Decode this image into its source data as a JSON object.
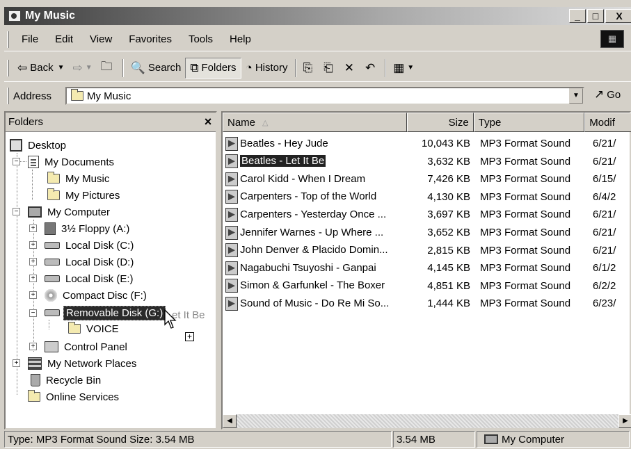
{
  "window": {
    "title": "My Music"
  },
  "menu": [
    "File",
    "Edit",
    "View",
    "Favorites",
    "Tools",
    "Help"
  ],
  "toolbar": {
    "back": "Back",
    "search": "Search",
    "folders": "Folders",
    "history": "History"
  },
  "address": {
    "label": "Address",
    "value": "My Music",
    "go": "Go"
  },
  "folders_pane": {
    "title": "Folders",
    "tree": [
      {
        "label": "Desktop",
        "icon": "desktop-icon"
      },
      {
        "label": "My Documents",
        "icon": "documents-icon"
      },
      {
        "label": "My Music",
        "icon": "folder-icon"
      },
      {
        "label": "My Pictures",
        "icon": "pictures-folder-icon"
      },
      {
        "label": "My Computer",
        "icon": "computer-icon"
      },
      {
        "label": "3½ Floppy (A:)",
        "icon": "floppy-icon"
      },
      {
        "label": "Local Disk (C:)",
        "icon": "drive-icon"
      },
      {
        "label": "Local Disk (D:)",
        "icon": "drive-icon"
      },
      {
        "label": "Local Disk (E:)",
        "icon": "drive-icon"
      },
      {
        "label": "Compact Disc (F:)",
        "icon": "cd-icon"
      },
      {
        "label": "Removable Disk (G:)",
        "icon": "removable-drive-icon"
      },
      {
        "label": "VOICE",
        "icon": "folder-icon"
      },
      {
        "label": "Control Panel",
        "icon": "control-panel-icon"
      },
      {
        "label": "My Network Places",
        "icon": "network-icon"
      },
      {
        "label": "Recycle Bin",
        "icon": "recycle-bin-icon"
      },
      {
        "label": "Online Services",
        "icon": "folder-icon"
      }
    ],
    "drag_ghost": "et It Be"
  },
  "list": {
    "columns": [
      "Name",
      "Size",
      "Type",
      "Modif"
    ],
    "rows": [
      {
        "name": "Beatles - Hey Jude",
        "size": "10,043 KB",
        "type": "MP3 Format Sound",
        "modified": "6/21/"
      },
      {
        "name": "Beatles - Let It Be",
        "size": "3,632 KB",
        "type": "MP3 Format Sound",
        "modified": "6/21/"
      },
      {
        "name": "Carol Kidd - When I Dream",
        "size": "7,426 KB",
        "type": "MP3 Format Sound",
        "modified": "6/15/"
      },
      {
        "name": "Carpenters - Top of the World",
        "size": "4,130 KB",
        "type": "MP3 Format Sound",
        "modified": "6/4/2"
      },
      {
        "name": "Carpenters - Yesterday Once ...",
        "size": "3,697 KB",
        "type": "MP3 Format Sound",
        "modified": "6/21/"
      },
      {
        "name": "Jennifer Warnes - Up Where ...",
        "size": "3,652 KB",
        "type": "MP3 Format Sound",
        "modified": "6/21/"
      },
      {
        "name": "John Denver & Placido Domin...",
        "size": "2,815 KB",
        "type": "MP3 Format Sound",
        "modified": "6/21/"
      },
      {
        "name": "Nagabuchi Tsuyoshi - Ganpai",
        "size": "4,145 KB",
        "type": "MP3 Format Sound",
        "modified": "6/1/2"
      },
      {
        "name": "Simon & Garfunkel - The Boxer",
        "size": "4,851 KB",
        "type": "MP3 Format Sound",
        "modified": "6/2/2"
      },
      {
        "name": "Sound of Music - Do Re Mi So...",
        "size": "1,444 KB",
        "type": "MP3 Format Sound",
        "modified": "6/23/"
      }
    ],
    "selected_index": 1
  },
  "status": {
    "info": "Type: MP3 Format Sound Size: 3.54 MB",
    "size": "3.54 MB",
    "zone": "My Computer"
  }
}
